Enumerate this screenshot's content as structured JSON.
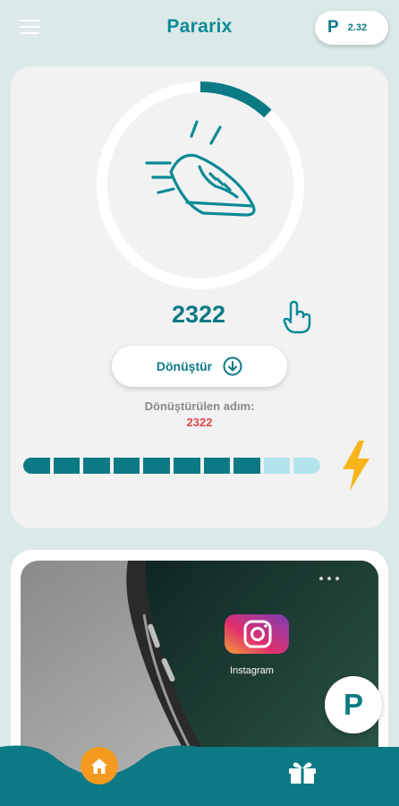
{
  "header": {
    "title": "Pararix",
    "menu_icon": "hamburger-menu-icon",
    "balance": {
      "logo": "P",
      "value": "2.32"
    }
  },
  "steps": {
    "count": "2322",
    "ring_progress": 0.12,
    "convert_button_label": "Dönüştür",
    "converted_label": "Dönüştürülen adım:",
    "converted_value": "2322",
    "energy_segments_total": 10,
    "energy_segments_filled": 8
  },
  "ad": {
    "image_text": "Instagram",
    "p_button_label": "P"
  },
  "bottom_nav": {
    "home_icon": "home-icon",
    "gift_icon": "gift-icon"
  },
  "colors": {
    "primary": "#0b7a85",
    "accent_orange": "#f59a1f",
    "accent_red": "#e0474f",
    "bolt_yellow": "#f7b51c",
    "background": "#dbe9e8"
  }
}
